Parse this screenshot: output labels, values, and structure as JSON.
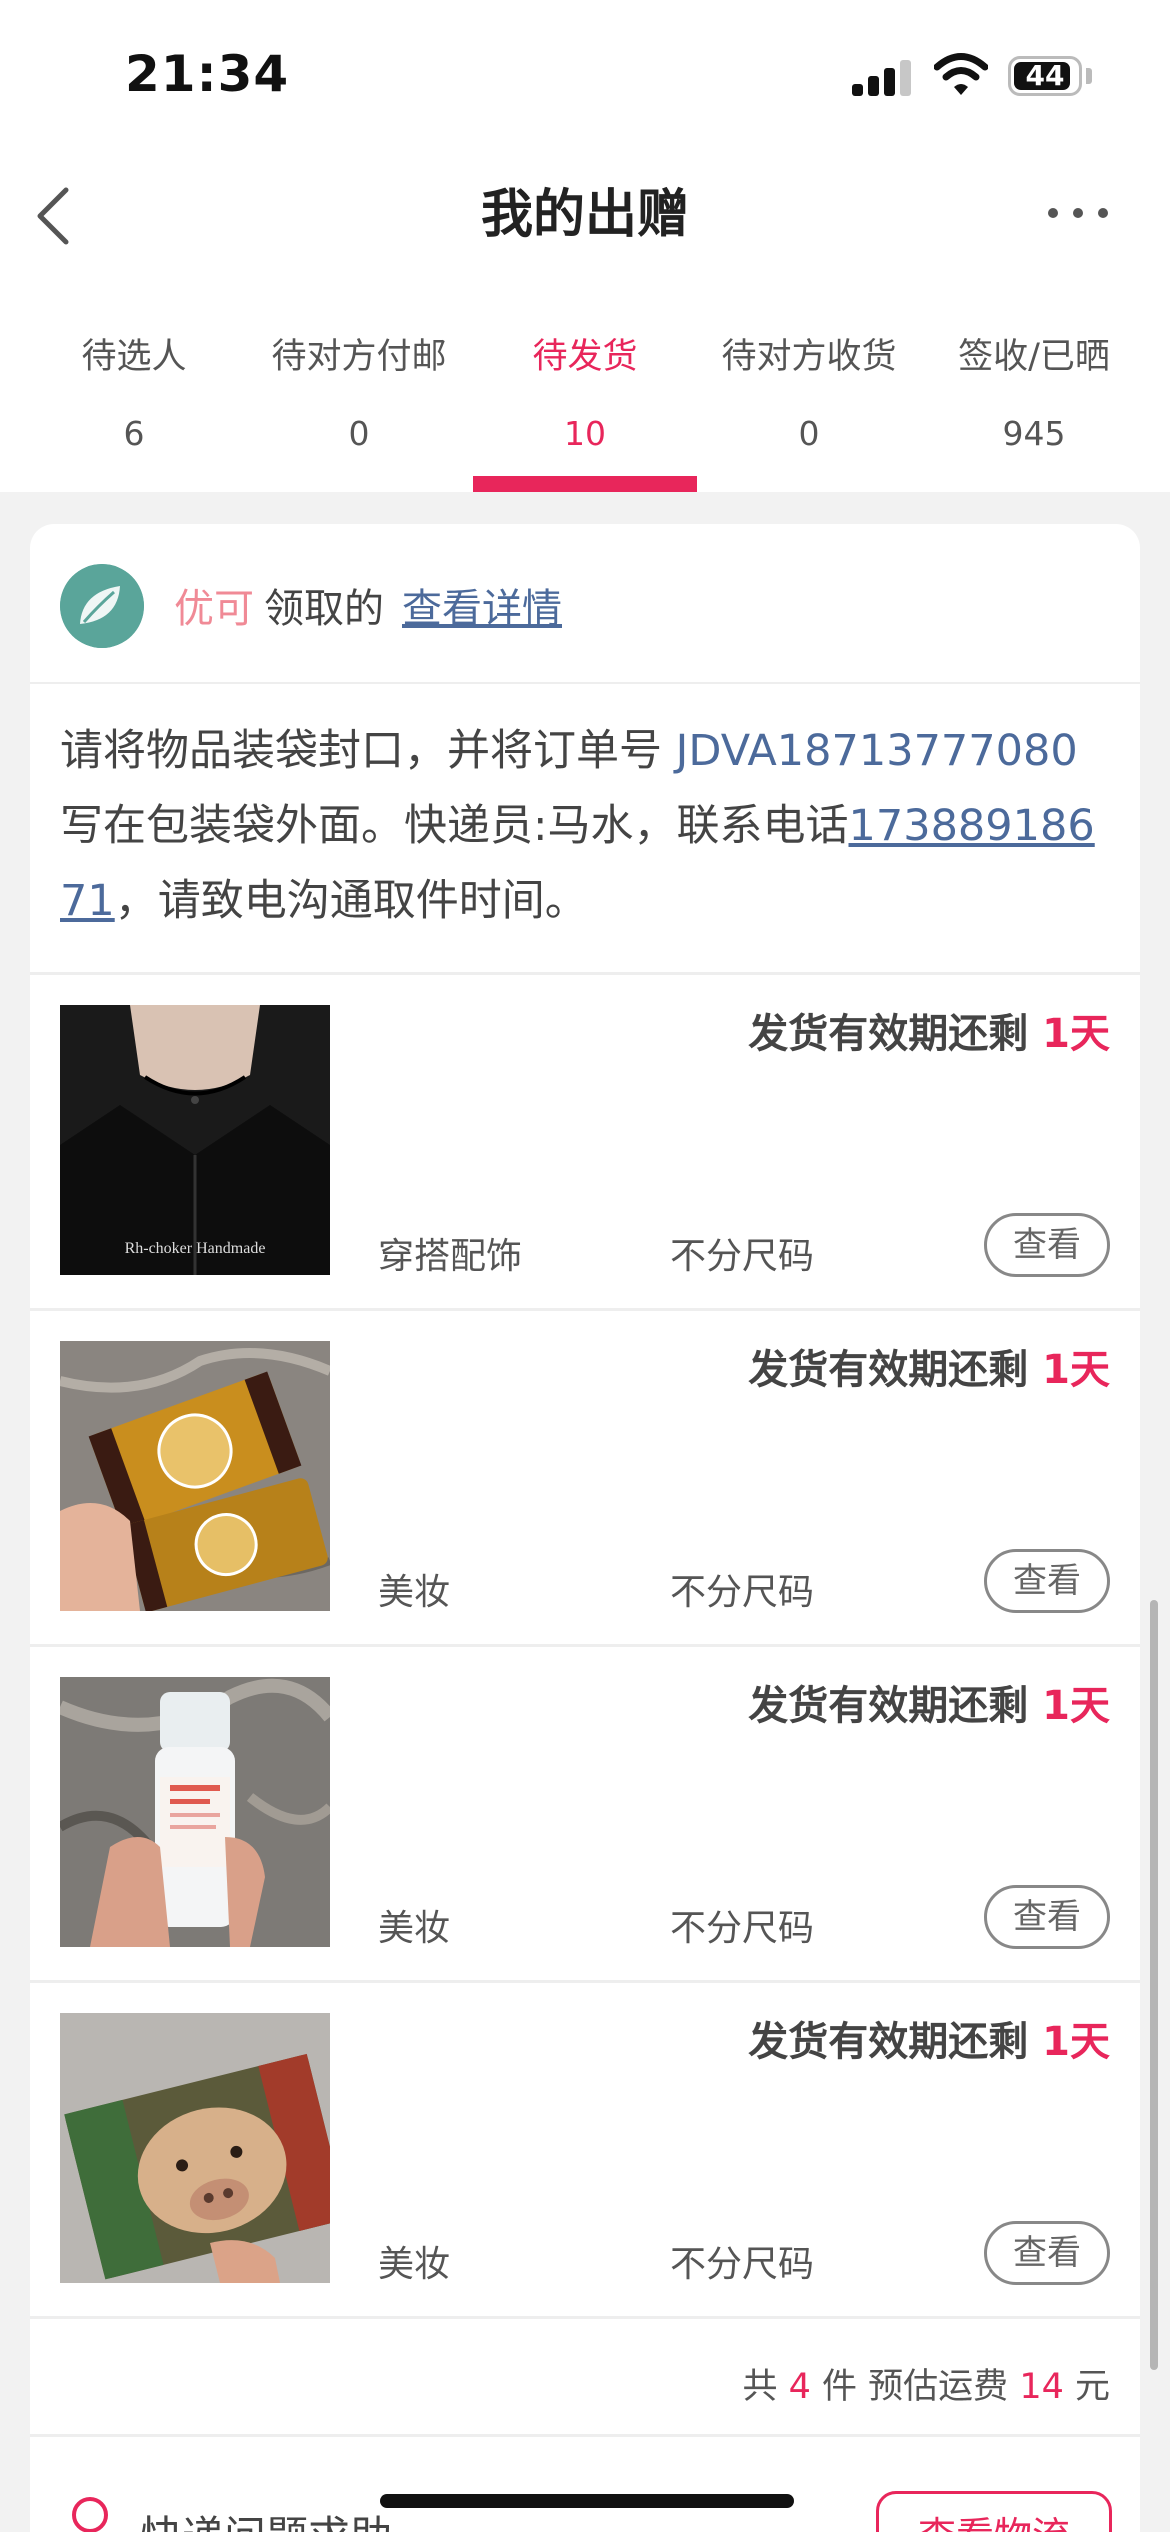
{
  "status_bar": {
    "time": "21:34",
    "battery": "44",
    "icons": [
      "signal-icon",
      "wifi-icon",
      "battery-icon"
    ]
  },
  "nav": {
    "title": "我的出赠",
    "back_icon": "chevron-left-icon",
    "more_icon": "more-horizontal-icon"
  },
  "tabs": [
    {
      "label": "待选人",
      "count": "6"
    },
    {
      "label": "待对方付邮",
      "count": "0"
    },
    {
      "label": "待发货",
      "count": "10",
      "active": true
    },
    {
      "label": "待对方收货",
      "count": "0"
    },
    {
      "label": "签收/已晒",
      "count": "945"
    }
  ],
  "card": {
    "recipient": {
      "name": "优可",
      "claimed_text": "领取的",
      "detail_link": "查看详情"
    },
    "instruction": {
      "part1": "请将物品装袋封口，并将订单号 ",
      "order_no": "JDVA18713777080",
      "part2": " 写在包装袋外面。快递员:马水，联系电话",
      "phone": "17388918671",
      "part3": "，请致电沟通取件时间。"
    },
    "items": [
      {
        "deadline_prefix": "发货有效期还剩 ",
        "deadline_days": "1天",
        "category": "穿搭配饰",
        "size": "不分尺码",
        "view_label": "查看",
        "thumb_caption": "Rh-choker Handmade"
      },
      {
        "deadline_prefix": "发货有效期还剩 ",
        "deadline_days": "1天",
        "category": "美妆",
        "size": "不分尺码",
        "view_label": "查看"
      },
      {
        "deadline_prefix": "发货有效期还剩 ",
        "deadline_days": "1天",
        "category": "美妆",
        "size": "不分尺码",
        "view_label": "查看"
      },
      {
        "deadline_prefix": "发货有效期还剩 ",
        "deadline_days": "1天",
        "category": "美妆",
        "size": "不分尺码",
        "view_label": "查看"
      }
    ],
    "summary": {
      "prefix": "共 ",
      "count": "4",
      "mid": " 件 预估运费 ",
      "fee": "14",
      "suffix": " 元"
    },
    "help": {
      "label": "快递问题求助",
      "logistics_button": "查看物流"
    }
  },
  "colors": {
    "accent": "#e8265b",
    "link": "#4c6a9b",
    "recipient_name": "#f08a96"
  }
}
